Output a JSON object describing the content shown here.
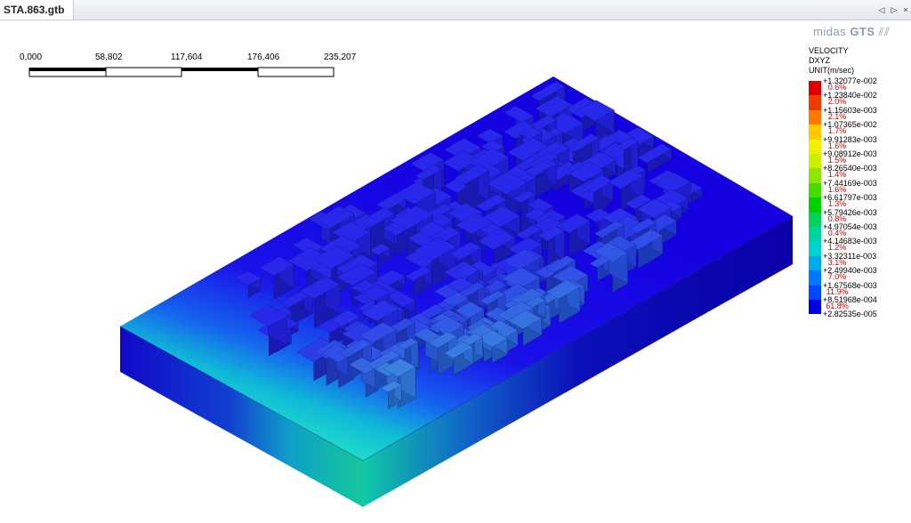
{
  "tab": {
    "title": "STA.863.gtb"
  },
  "nav": {
    "prev_icon": "◁",
    "next_icon": "▷",
    "close_icon": "×"
  },
  "scale_bar": {
    "labels": [
      "0,000",
      "58,802",
      "117,604",
      "176,406",
      "235,207"
    ]
  },
  "logo": {
    "brand": "midas",
    "product": "GTS"
  },
  "legend": {
    "title": "VELOCITY",
    "component": "DXYZ",
    "unit": "UNIT(m/sec)",
    "values": [
      "+1.32077e-002",
      "+1.23840e-002",
      "+1.15603e-003",
      "+1.07365e-002",
      "+9.91283e-003",
      "+9.08912e-003",
      "+8.26540e-003",
      "+7.44169e-003",
      "+6.61797e-003",
      "+5.79426e-003",
      "+4.97054e-003",
      "+4.14683e-003",
      "+3.32311e-003",
      "+2.49940e-003",
      "+1.67568e-003",
      "+8.51968e-004",
      "+2.82535e-005"
    ],
    "percentages": [
      "0.6%",
      "2.0%",
      "2.1%",
      "1.7%",
      "1.6%",
      "1.5%",
      "1.4%",
      "1.6%",
      "1.3%",
      "0.8%",
      "0.4%",
      "1.2%",
      "3.1%",
      "7.0%",
      "11.9%",
      "61.8%"
    ],
    "colors": [
      "#e00000",
      "#f03a00",
      "#ff7a00",
      "#ffc800",
      "#f0f000",
      "#c8f000",
      "#8ce600",
      "#46dc00",
      "#00d200",
      "#00d25a",
      "#00d2a0",
      "#00d2d2",
      "#00aaf0",
      "#0078ff",
      "#0046ff",
      "#0000e6"
    ]
  }
}
